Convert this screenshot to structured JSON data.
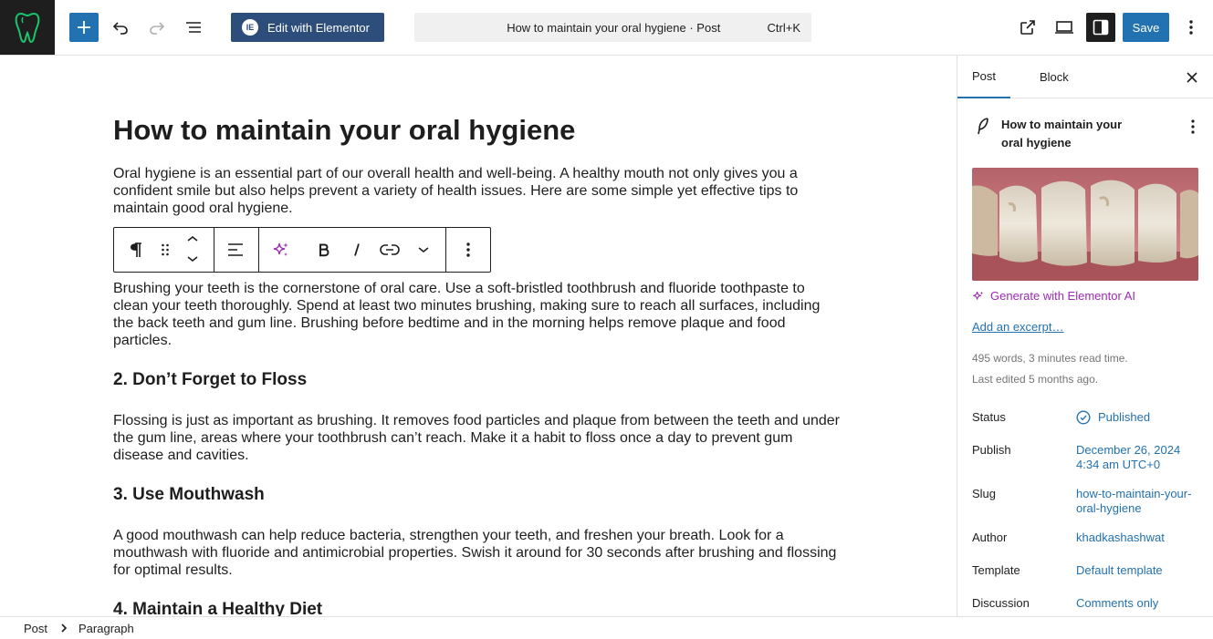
{
  "header": {
    "elementor_label": "Edit with Elementor",
    "command_title": "How to maintain your oral hygiene · Post",
    "command_shortcut": "Ctrl+K",
    "save_label": "Save"
  },
  "post": {
    "title": "How to maintain your oral hygiene",
    "intro": "Oral hygiene is an essential part of our overall health and well-being. A healthy mouth not only gives you a confident smile but also helps prevent a variety of health issues. Here are some simple yet effective tips to maintain good oral hygiene.",
    "brushing": "Brushing your teeth is the cornerstone of oral care. Use a soft-bristled toothbrush and fluoride toothpaste to clean your teeth thoroughly. Spend at least two minutes brushing, making sure to reach all surfaces, including the back teeth and gum line. Brushing before bedtime and in the morning helps remove plaque and food particles.",
    "h_floss": "2. Don’t Forget to Floss",
    "floss": "Flossing is just as important as brushing. It removes food particles and plaque from between the teeth and under the gum line, areas where your toothbrush can’t reach. Make it a habit to floss once a day to prevent gum disease and cavities.",
    "h_mouthwash": "3. Use Mouthwash",
    "mouthwash": "A good mouthwash can help reduce bacteria, strengthen your teeth, and freshen your breath. Look for a mouthwash with fluoride and antimicrobial properties. Swish it around for 30 seconds after brushing and flossing for optimal results.",
    "h_diet": "4. Maintain a Healthy Diet"
  },
  "sidebar": {
    "tab_post": "Post",
    "tab_block": "Block",
    "summary_title": "How to maintain your oral hygiene",
    "generate_ai": "Generate with Elementor AI",
    "excerpt_link": "Add an excerpt…",
    "word_count": "495 words, 3 minutes read time.",
    "last_edited": "Last edited 5 months ago.",
    "rows": {
      "status_label": "Status",
      "status_value": "Published",
      "publish_label": "Publish",
      "publish_value": "December 26, 2024 4:34 am UTC+0",
      "slug_label": "Slug",
      "slug_value": "how-to-maintain-your-oral-hygiene",
      "author_label": "Author",
      "author_value": "khadkashashwat",
      "template_label": "Template",
      "template_value": "Default template",
      "discussion_label": "Discussion",
      "discussion_value": "Comments only"
    }
  },
  "footer": {
    "crumb_post": "Post",
    "crumb_paragraph": "Paragraph"
  },
  "icons": [
    "tooth-logo-icon",
    "plus-icon",
    "undo-icon",
    "redo-icon",
    "list-view-icon",
    "elementor-icon",
    "external-link-icon",
    "desktop-preview-icon",
    "sidebar-toggle-icon",
    "more-vertical-icon",
    "paragraph-icon",
    "drag-handle-icon",
    "move-up-icon",
    "move-down-icon",
    "align-icon",
    "ai-sparkle-icon",
    "bold-icon",
    "italic-icon",
    "link-icon",
    "chevron-down-icon",
    "close-icon",
    "feather-icon",
    "check-circle-icon",
    "chevron-right-icon"
  ],
  "colors": {
    "accent": "#2271b1",
    "elementor": "#2d4d7a",
    "logo_tooth": "#1bc46a",
    "ai_purple": "#9b2ab5"
  }
}
